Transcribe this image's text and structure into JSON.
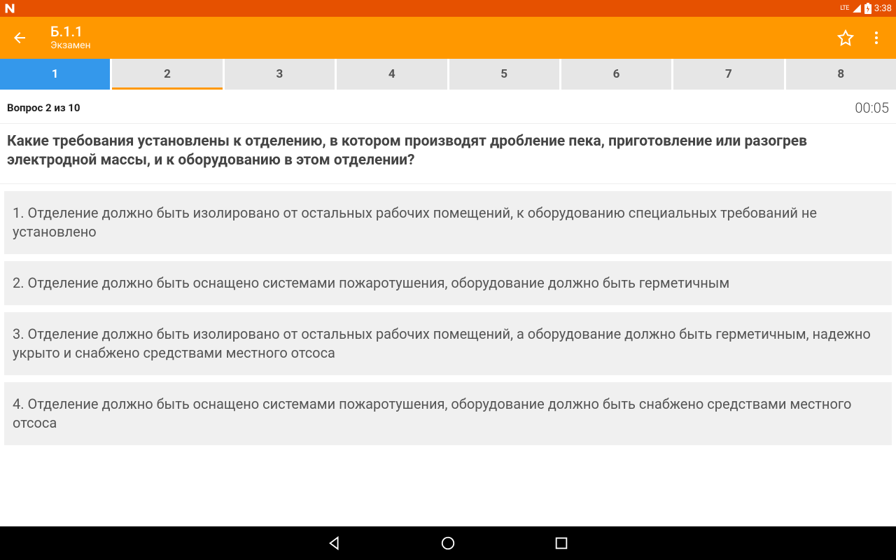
{
  "status": {
    "time": "3:38",
    "lte": "LTE",
    "battery_charging": true
  },
  "header": {
    "title": "Б.1.1",
    "subtitle": "Экзамен"
  },
  "tabs": [
    "1",
    "2",
    "3",
    "4",
    "5",
    "6",
    "7",
    "8"
  ],
  "active_tab_index": 0,
  "current_tab_index": 1,
  "question_meta": "Вопрос 2 из 10",
  "timer": "00:05",
  "question_text": "Какие требования установлены к отделению, в котором производят дробление пека, приготовление или разогрев электродной массы, и к оборудованию в этом отделении?",
  "answers": [
    "1. Отделение должно быть изолировано от остальных рабочих помещений, к оборудованию специальных требований не установлено",
    "2. Отделение должно быть оснащено системами пожаротушения, оборудование должно быть герметичным",
    "3. Отделение должно быть изолировано от остальных рабочих помещений, а оборудование должно быть герметичным, надежно укрыто и снабжено средствами местного отсоса",
    "4. Отделение должно быть оснащено системами пожаротушения, оборудование должно быть снабжено средствами местного отсоса"
  ]
}
